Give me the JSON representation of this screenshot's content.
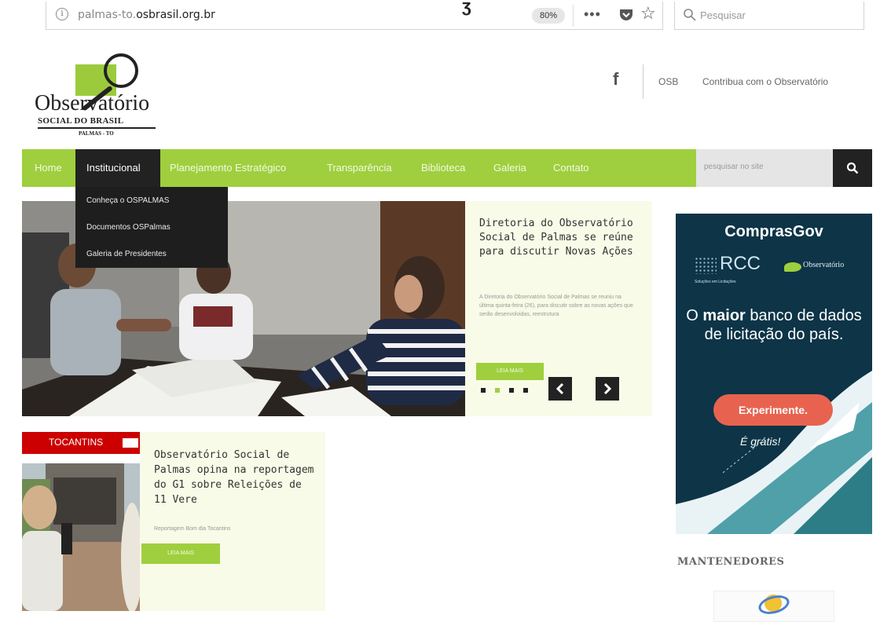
{
  "browser": {
    "url_prefix": "palmas-to.",
    "url_domain": "osbrasil.org.br",
    "zoom": "80%",
    "search_placeholder": "Pesquisar"
  },
  "header": {
    "logo_name": "Observatório",
    "logo_sub": "SOCIAL DO BRASIL",
    "logo_city": "PALMAS - TO",
    "facebook_glyph": "f",
    "link_osb": "OSB",
    "link_contribua": "Contribua com o Observatório"
  },
  "nav": {
    "items": [
      {
        "label": "Home"
      },
      {
        "label": "Institucional"
      },
      {
        "label": "Planejamento Estratégico"
      },
      {
        "label": "Transparência"
      },
      {
        "label": "Biblioteca"
      },
      {
        "label": "Galeria"
      },
      {
        "label": "Contato"
      }
    ],
    "search_placeholder": "pesquisar no site",
    "dropdown": [
      {
        "label": "Conheça o OSPALMAS"
      },
      {
        "label": "Documentos OSPalmas"
      },
      {
        "label": "Galeria de Presidentes"
      }
    ]
  },
  "slider": {
    "title": "Diretoria do Observatório Social de Palmas se reúne para discutir Novas Ações",
    "excerpt": "A Diretoria do Observatório Social de Palmas se reuniu na última quinta-feira (26), para discutir sobre as novas ações que serão desenvolvidas, reestrutura",
    "read_more": "LEIA MAIS",
    "slide_count": 4,
    "active_slide": 2
  },
  "news": {
    "tag": "TOCANTINS",
    "title": "Observatório Social de Palmas opina na reportagem do G1 sobre Releições de 11 Vere",
    "subtitle": "Reportagem Bom dia Tocantins",
    "read_more": "LEIA MAIS"
  },
  "ad": {
    "title": "ComprasGov",
    "rcc": "RCC",
    "rcc_sub": "Soluções em Licitações",
    "observatorio": "Observatório",
    "text_pre": "O ",
    "text_bold": "maior",
    "text_post": " banco de dados de licitação do país.",
    "cta": "Experimente.",
    "free": "É grátis!"
  },
  "sidebar": {
    "mantenedores": "MANTENEDORES"
  },
  "colors": {
    "brand_green": "#9fcf3e",
    "nav_dark": "#222222",
    "ad_bg": "#0d3447",
    "ad_cta": "#e8634f",
    "news_red": "#cc0000"
  },
  "icons": {
    "info": "info-icon",
    "more": "more-icon",
    "pocket": "pocket-icon",
    "star": "bookmark-star-icon",
    "search": "search-icon",
    "facebook": "facebook-icon",
    "prev": "chevron-left-icon",
    "next": "chevron-right-icon"
  }
}
